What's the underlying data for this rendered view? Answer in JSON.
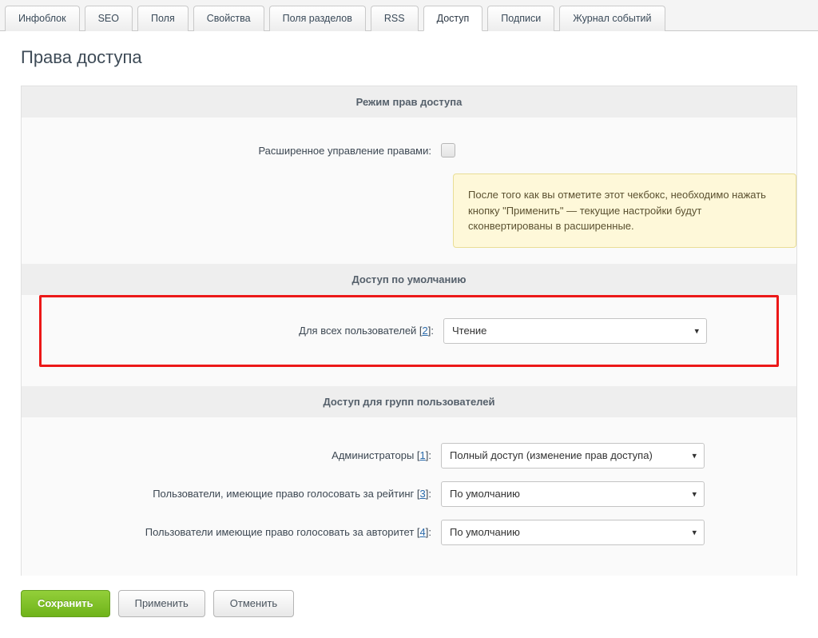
{
  "tabs": {
    "items": [
      "Инфоблок",
      "SEO",
      "Поля",
      "Свойства",
      "Поля разделов",
      "RSS",
      "Доступ",
      "Подписи",
      "Журнал событий"
    ],
    "active_index": 6
  },
  "title": "Права доступа",
  "sections": {
    "mode_header": "Режим прав доступа",
    "default_header": "Доступ по умолчанию",
    "groups_header": "Доступ для групп пользователей"
  },
  "advanced": {
    "label": "Расширенное управление правами:",
    "checked": false
  },
  "notice": "После того как вы отметите этот чекбокс, необходимо нажать кнопку \"Применить\" — текущие настройки будут сконвертированы в расширенные.",
  "default_access": {
    "label_prefix": "Для всех пользователей [",
    "id": "2",
    "label_suffix": "]:",
    "value": "Чтение"
  },
  "groups": [
    {
      "label_prefix": "Администраторы [",
      "id": "1",
      "label_suffix": "]:",
      "value": "Полный доступ (изменение прав доступа)"
    },
    {
      "label_prefix": "Пользователи, имеющие право голосовать за рейтинг [",
      "id": "3",
      "label_suffix": "]:",
      "value": "По умолчанию"
    },
    {
      "label_prefix": "Пользователи имеющие право голосовать за авторитет [",
      "id": "4",
      "label_suffix": "]:",
      "value": "По умолчанию"
    }
  ],
  "buttons": {
    "save": "Сохранить",
    "apply": "Применить",
    "cancel": "Отменить"
  }
}
